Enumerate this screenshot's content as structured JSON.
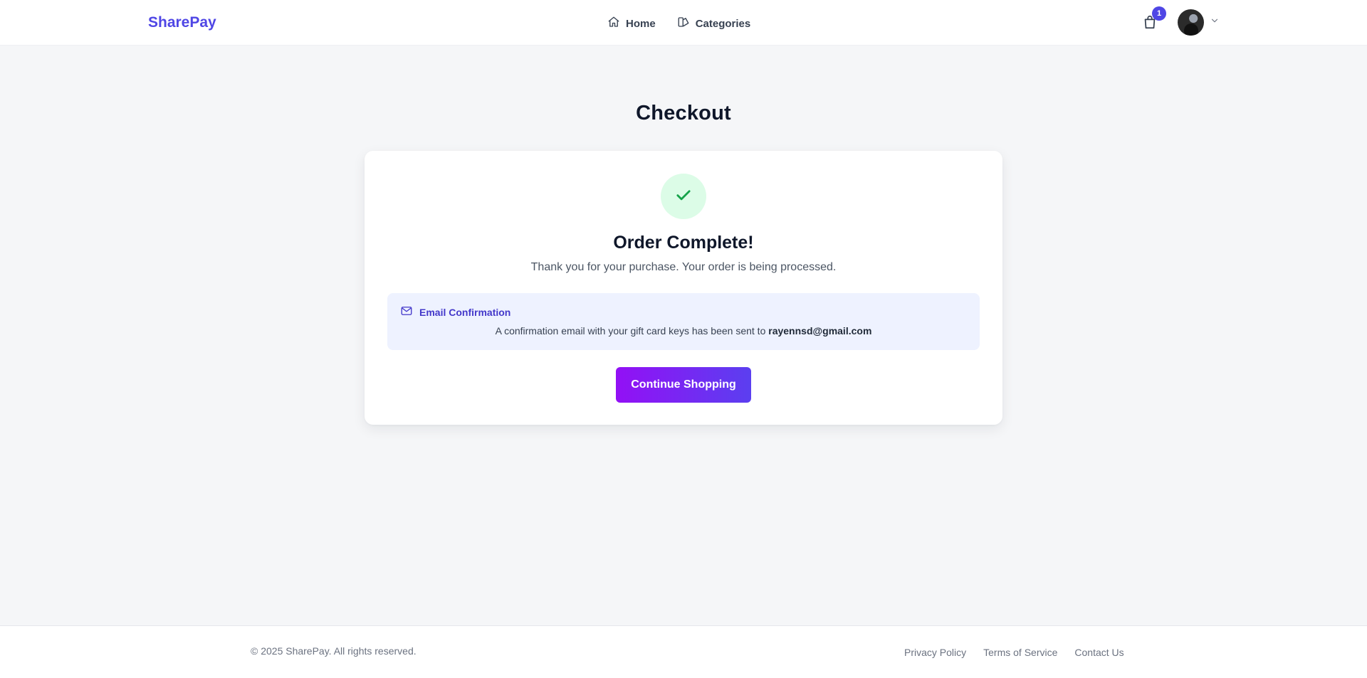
{
  "header": {
    "brand": "SharePay",
    "nav": [
      {
        "label": "Home",
        "icon": "home-icon"
      },
      {
        "label": "Categories",
        "icon": "categories-icon"
      }
    ],
    "cart_count": "1",
    "avatar_menu_icon": "chevron-down-icon"
  },
  "page": {
    "title": "Checkout"
  },
  "order": {
    "status_icon": "check-icon",
    "title": "Order Complete!",
    "subtitle": "Thank you for your purchase. Your order is being processed.",
    "email_box": {
      "icon": "mail-icon",
      "heading": "Email Confirmation",
      "message": "A confirmation email with your gift card keys has been sent to",
      "email": "rayennsd@gmail.com"
    },
    "cta_label": "Continue Shopping"
  },
  "footer": {
    "copyright": "© 2025 SharePay. All rights reserved.",
    "links": [
      "Privacy Policy",
      "Terms of Service",
      "Contact Us"
    ]
  },
  "colors": {
    "brand": "#4f46e5",
    "success_bg": "#dcfce7",
    "success": "#16a34a",
    "info_bg": "#eef2ff",
    "cta_gradient_start": "#9310f5",
    "cta_gradient_end": "#5b3ff0"
  }
}
